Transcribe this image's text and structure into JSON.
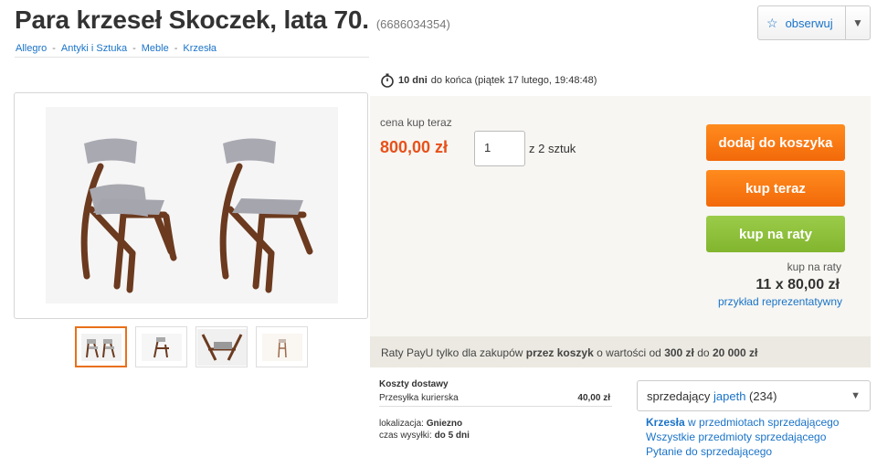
{
  "title": "Para krzeseł Skoczek, lata 70.",
  "offer_id": "(6686034354)",
  "follow": {
    "label": "obserwuj",
    "icon": "star-icon"
  },
  "breadcrumb": [
    {
      "label": "Allegro"
    },
    {
      "label": "Antyki i Sztuka"
    },
    {
      "label": "Meble"
    },
    {
      "label": "Krzesła"
    }
  ],
  "breadcrumb_sep": "-",
  "timer": {
    "days": "10 dni",
    "rest": "do końca (piątek 17 lutego, 19:48:48)"
  },
  "buy": {
    "price_label": "cena kup teraz",
    "price": "800,00 zł",
    "quantity": "1",
    "quantity_of": "z 2 sztuk",
    "add_to_cart": "dodaj do koszyka",
    "buy_now": "kup teraz",
    "buy_installments": "kup na raty",
    "installments_label": "kup na raty",
    "installments_value": "11 x 80,00 zł",
    "installments_link": "przykład reprezentatywny"
  },
  "payu": {
    "text1": "Raty PayU tylko dla zakupów",
    "bold1": "przez koszyk",
    "text2": "o wartości od",
    "min": "300 zł",
    "text3": "do",
    "max": "20 000 zł"
  },
  "shipping": {
    "title": "Koszty dostawy",
    "method": "Przesyłka kurierska",
    "cost": "40,00 zł",
    "location_label": "lokalizacja:",
    "location": "Gniezno",
    "dispatch_label": "czas wysyłki:",
    "dispatch": "do 5 dni"
  },
  "seller": {
    "label": "sprzedający",
    "name": "japeth",
    "rating": "(234)",
    "links": {
      "category_bold": "Krzesła",
      "category_rest": "w przedmiotach sprzedającego",
      "all_items": "Wszystkie przedmioty sprzedającego",
      "question": "Pytanie do sprzedającego"
    }
  },
  "colors": {
    "accent_orange": "#f2690a",
    "price_red": "#e8501a",
    "installments_green": "#82b52e",
    "link_blue": "#1a73c8"
  }
}
